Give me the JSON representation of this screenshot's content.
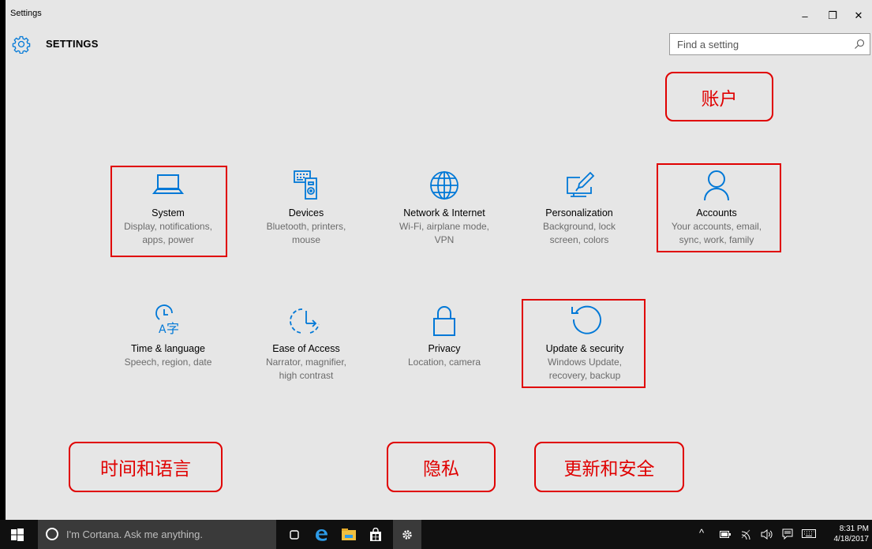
{
  "window": {
    "title": "Settings",
    "controls": {
      "minimize": "–",
      "maximize": "❐",
      "close": "✕"
    }
  },
  "header": {
    "heading": "SETTINGS",
    "search_placeholder": "Find a setting"
  },
  "tiles": [
    {
      "name": "System",
      "desc1": "Display, notifications,",
      "desc2": "apps, power",
      "desc3": "",
      "icon": "laptop-icon"
    },
    {
      "name": "Devices",
      "desc1": "Bluetooth, printers,",
      "desc2": "mouse",
      "desc3": "",
      "icon": "devices-icon"
    },
    {
      "name": "Network & Internet",
      "desc1": "Wi-Fi, airplane mode,",
      "desc2": "VPN",
      "desc3": "",
      "icon": "globe-icon"
    },
    {
      "name": "Personalization",
      "desc1": "Background, lock",
      "desc2": "screen, colors",
      "desc3": "",
      "icon": "personalization-icon"
    },
    {
      "name": "Accounts",
      "desc1": "Your accounts, email,",
      "desc2": "sync, work, family",
      "desc3": "",
      "icon": "person-icon"
    },
    {
      "name": "Time & language",
      "desc1": "Speech, region, date",
      "desc2": "",
      "desc3": "",
      "icon": "time-language-icon"
    },
    {
      "name": "Ease of Access",
      "desc1": "Narrator, magnifier,",
      "desc2": "high contrast",
      "desc3": "",
      "icon": "ease-of-access-icon"
    },
    {
      "name": "Privacy",
      "desc1": "Location, camera",
      "desc2": "",
      "desc3": "",
      "icon": "lock-icon"
    },
    {
      "name": "Update & security",
      "desc1": "Windows Update,",
      "desc2": "recovery, backup",
      "desc3": "",
      "icon": "refresh-icon"
    }
  ],
  "annotations": {
    "accounts": "账户",
    "time_language": "时间和语言",
    "privacy": "隐私",
    "update_security": "更新和安全"
  },
  "taskbar": {
    "cortana_placeholder": "I'm Cortana. Ask me anything.",
    "time": "8:31 PM",
    "date": "4/18/2017"
  },
  "colors": {
    "accent": "#0078d7",
    "window_bg": "#e6e6e6",
    "annotation": "#e00000",
    "taskbar": "#101010"
  }
}
